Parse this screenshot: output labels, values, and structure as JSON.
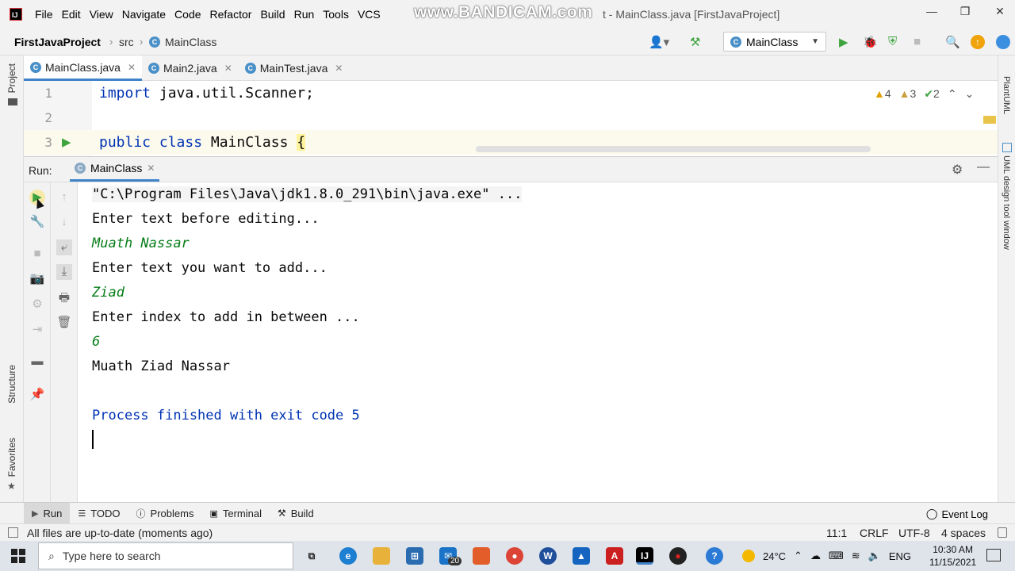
{
  "menubar": {
    "items": [
      "File",
      "Edit",
      "View",
      "Navigate",
      "Code",
      "Refactor",
      "Build",
      "Run",
      "Tools",
      "VCS"
    ],
    "watermark": "www.BANDICAM.com",
    "title": "t - MainClass.java [FirstJavaProject]",
    "controls": [
      "—",
      "❐",
      "✕"
    ]
  },
  "navbar": {
    "project": "FirstJavaProject",
    "src": "src",
    "class": "MainClass",
    "run_config": "MainClass"
  },
  "left_strip": {
    "project": "Project",
    "structure": "Structure",
    "favorites": "Favorites"
  },
  "right_strip": {
    "plantuml": "PlantUML",
    "uml_design": "UML design tool window"
  },
  "tabs": [
    {
      "label": "MainClass.java"
    },
    {
      "label": "Main2.java"
    },
    {
      "label": "MainTest.java"
    }
  ],
  "editor": {
    "lines": [
      {
        "num": "1",
        "text": "import java.util.Scanner;"
      },
      {
        "num": "2",
        "text": ""
      },
      {
        "num": "3",
        "kw": "public class",
        "name": " MainClass ",
        "brace": "{"
      }
    ],
    "inspections": {
      "warnings": "4",
      "weak": "3",
      "typos": "2"
    }
  },
  "run_panel": {
    "label": "Run:",
    "tab": "MainClass",
    "console": [
      {
        "text": "\"C:\\Program Files\\Java\\jdk1.8.0_291\\bin\\java.exe\" ...",
        "kind": "cmd"
      },
      {
        "text": "Enter text before editing...",
        "kind": "out"
      },
      {
        "text": "Muath Nassar",
        "kind": "input"
      },
      {
        "text": "Enter text you want to add...",
        "kind": "out"
      },
      {
        "text": "Ziad",
        "kind": "input"
      },
      {
        "text": "Enter index to add in between ...",
        "kind": "out"
      },
      {
        "text": "6",
        "kind": "input"
      },
      {
        "text": "Muath Ziad Nassar",
        "kind": "out"
      },
      {
        "text": "",
        "kind": "out"
      },
      {
        "text": "Process finished with exit code 5",
        "kind": "exit"
      }
    ]
  },
  "bottom_tools": {
    "run": "Run",
    "todo": "TODO",
    "problems": "Problems",
    "terminal": "Terminal",
    "build": "Build",
    "event_log": "Event Log"
  },
  "statusbar": {
    "message": "All files are up-to-date (moments ago)",
    "position": "11:1",
    "line_sep": "CRLF",
    "encoding": "UTF-8",
    "indent": "4 spaces"
  },
  "taskbar": {
    "search_placeholder": "Type here to search",
    "mail_badge": "20",
    "weather": "24°C",
    "lang": "ENG",
    "time": "10:30 AM",
    "date": "11/15/2021"
  },
  "colors": {
    "accent": "#4083c9",
    "keyword": "#0033b3",
    "input": "#067d17",
    "run_green": "#3fa33f"
  }
}
